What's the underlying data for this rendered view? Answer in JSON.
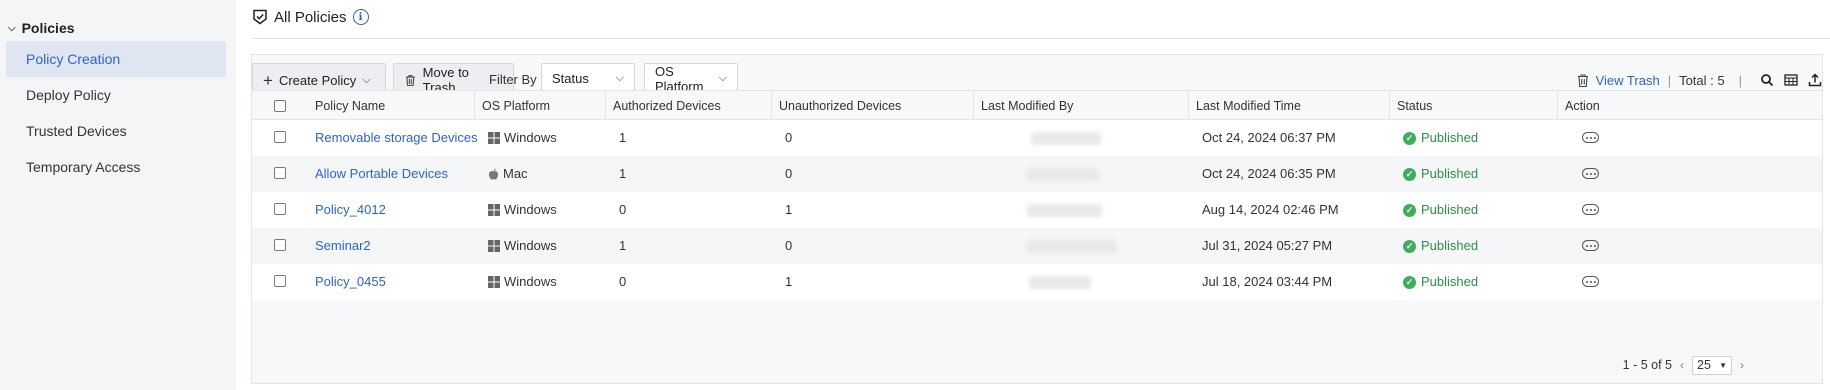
{
  "sidebar": {
    "section": "Policies",
    "items": [
      {
        "label": "Policy Creation",
        "active": true
      },
      {
        "label": "Deploy Policy"
      },
      {
        "label": "Trusted Devices"
      },
      {
        "label": "Temporary Access"
      }
    ]
  },
  "header": {
    "title": "All Policies",
    "info": "i"
  },
  "toolbar": {
    "create_label": "Create Policy",
    "trash_label": "Move to Trash",
    "filter_label": "Filter By :",
    "status_select": "Status",
    "os_select": "OS Platform",
    "view_trash": "View Trash",
    "total": "Total : 5"
  },
  "table": {
    "columns": [
      "Policy Name",
      "OS Platform",
      "Authorized Devices",
      "Unauthorized Devices",
      "Last Modified By",
      "Last Modified Time",
      "Status",
      "Action"
    ],
    "rows": [
      {
        "name": "Removable storage Devices",
        "os": "Windows",
        "authorized": "1",
        "unauthorized": "0",
        "modified_time": "Oct 24, 2024 06:37 PM",
        "status": "Published"
      },
      {
        "name": "Allow Portable Devices",
        "os": "Mac",
        "authorized": "1",
        "unauthorized": "0",
        "modified_time": "Oct 24, 2024 06:35 PM",
        "status": "Published"
      },
      {
        "name": "Policy_4012",
        "os": "Windows",
        "authorized": "0",
        "unauthorized": "1",
        "modified_time": "Aug 14, 2024 02:46 PM",
        "status": "Published"
      },
      {
        "name": "Seminar2",
        "os": "Windows",
        "authorized": "1",
        "unauthorized": "0",
        "modified_time": "Jul 31, 2024 05:27 PM",
        "status": "Published"
      },
      {
        "name": "Policy_0455",
        "os": "Windows",
        "authorized": "0",
        "unauthorized": "1",
        "modified_time": "Jul 18, 2024 03:44 PM",
        "status": "Published"
      }
    ]
  },
  "pager": {
    "range": "1 - 5 of 5",
    "per_page": "25",
    "prev": "‹",
    "next": "›"
  },
  "colors": {
    "accent": "#2e63c8",
    "success": "#3fae5a",
    "sidebar_bg": "#f4f5f7",
    "active_bg": "#dfe6f1"
  }
}
